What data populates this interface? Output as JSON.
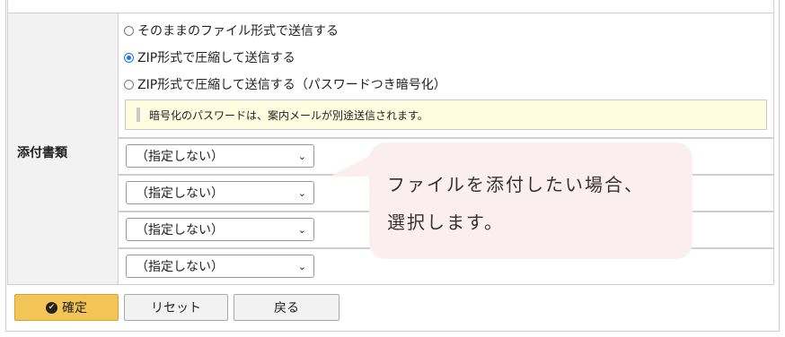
{
  "attachment": {
    "label": "添付書類",
    "send_options": [
      {
        "label": "そのままのファイル形式で送信する",
        "checked": false
      },
      {
        "label": "ZIP形式で圧縮して送信する",
        "checked": true
      },
      {
        "label": "ZIP形式で圧縮して送信する（パスワードつき暗号化）",
        "checked": false
      }
    ],
    "notice": "暗号化のパスワードは、案内メールが別途送信されます。",
    "file_selects": [
      "（指定しない）",
      "（指定しない）",
      "（指定しない）",
      "（指定しない）"
    ]
  },
  "callout": {
    "line1": "ファイルを添付したい場合、",
    "line2": "選択します。"
  },
  "buttons": {
    "confirm": "確定",
    "reset": "リセット",
    "back": "戻る"
  },
  "colors": {
    "confirm_bg": "#f3c556",
    "notice_bg": "#fffde0",
    "callout_bg": "#fbeeee",
    "radio_accent": "#1a73e8"
  }
}
